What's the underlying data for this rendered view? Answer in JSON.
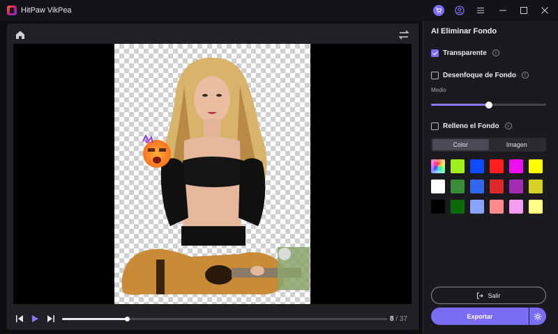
{
  "app": {
    "title": "HitPaw VikPea"
  },
  "titlebar_icons": [
    "cart-icon",
    "user-icon",
    "menu-icon",
    "minimize-icon",
    "maximize-icon",
    "close-icon"
  ],
  "preview": {
    "toolbar_icons": [
      "home-icon",
      "swap-icon"
    ],
    "playback": {
      "current_frame": "8",
      "separator": "/",
      "total_frames": "37",
      "progress": 0.2
    }
  },
  "panel": {
    "title": "AI Eliminar Fondo",
    "options": {
      "transparent": {
        "label": "Transparente",
        "checked": true
      },
      "blur": {
        "label": "Desenfoque de Fondo",
        "checked": false,
        "level_label": "Medio",
        "level": 0.5
      },
      "fill": {
        "label": "Relleno el Fondo",
        "checked": false
      }
    },
    "tabs": [
      {
        "label": "Color",
        "active": true
      },
      {
        "label": "Imagen",
        "active": false
      }
    ],
    "swatches": [
      "rainbow",
      "#9ef01a",
      "#0f4bff",
      "#ff1f1f",
      "#ee0ff0",
      "#ffff00",
      "#ffffff",
      "#3a8c3a",
      "#3366ee",
      "#dd2b2b",
      "#a42bb3",
      "#d6d224",
      "#000000",
      "#0b6b0b",
      "#88a6ff",
      "#ff8a8a",
      "#f59cf0",
      "#ffff88"
    ],
    "exit_label": "Salir",
    "export_label": "Exportar"
  },
  "colors": {
    "accent": "#7b6cf6",
    "background": "#0f0f12",
    "panel": "#1a1a1f"
  }
}
